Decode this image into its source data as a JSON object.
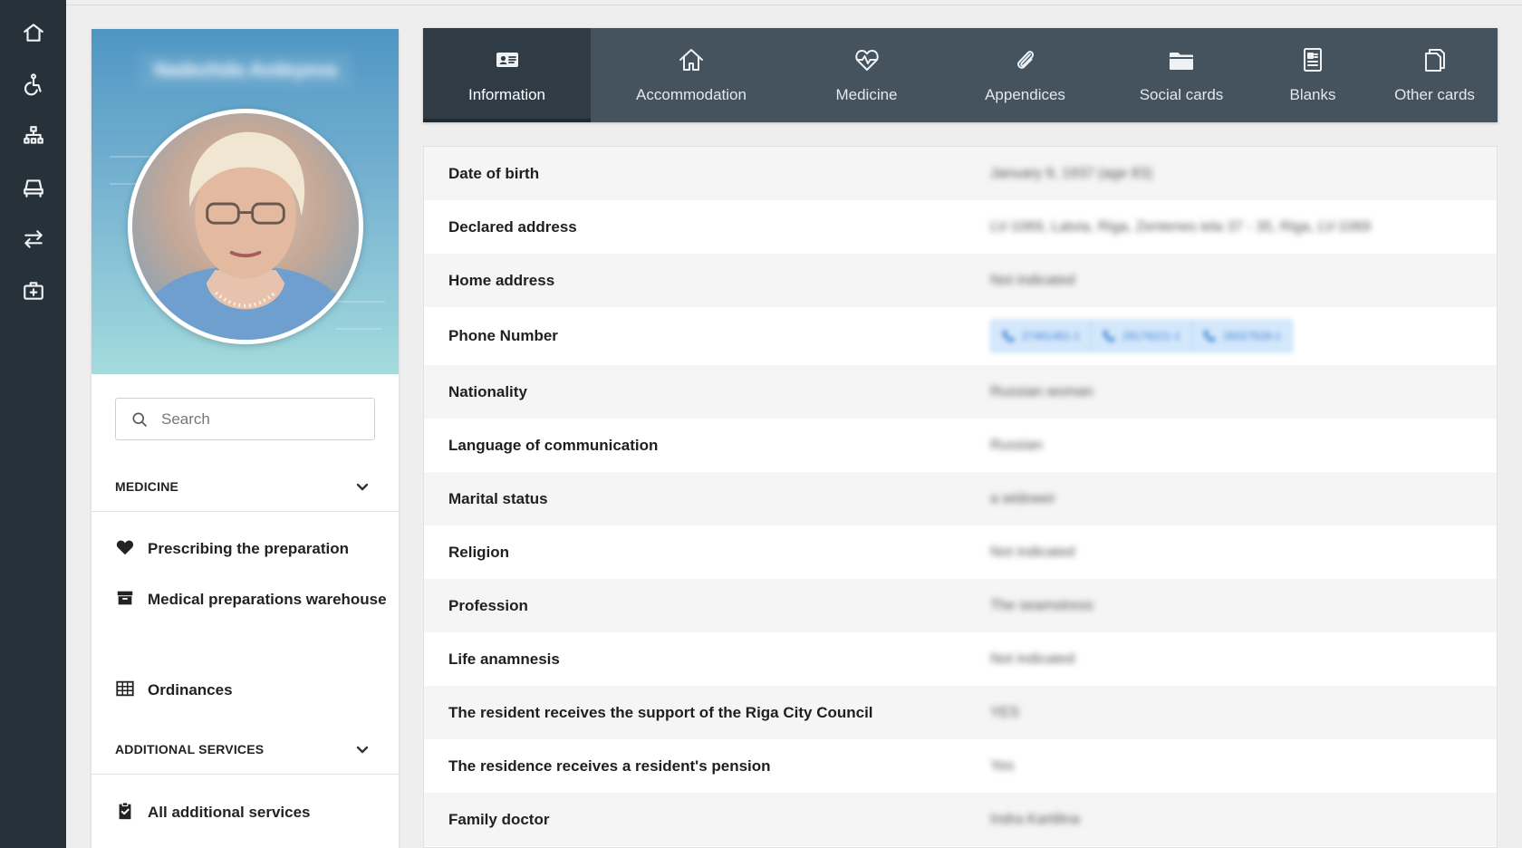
{
  "rail": {
    "items": [
      {
        "name": "home",
        "icon": "home-icon"
      },
      {
        "name": "accessibility",
        "icon": "wheelchair-icon"
      },
      {
        "name": "org-structure",
        "icon": "sitemap-icon"
      },
      {
        "name": "bed",
        "icon": "bed-icon"
      },
      {
        "name": "transfer",
        "icon": "arrows-exchange-icon"
      },
      {
        "name": "medical-kit",
        "icon": "first-aid-kit-icon"
      }
    ]
  },
  "profile": {
    "name": "Nadezhda Avdeyeva"
  },
  "search": {
    "placeholder": "Search"
  },
  "sections": {
    "medicine": {
      "title": "MEDICINE",
      "items": [
        {
          "label": "Prescribing the preparation",
          "icon": "heart-icon"
        },
        {
          "label": "Medical preparations warehouse",
          "icon": "archive-box-icon"
        },
        {
          "label": "Ordinances",
          "icon": "table-icon"
        }
      ]
    },
    "additional": {
      "title": "ADDITIONAL SERVICES",
      "items": [
        {
          "label": "All additional services",
          "icon": "clipboard-check-icon"
        }
      ]
    }
  },
  "tabs": [
    {
      "label": "Information",
      "icon": "id-card-icon",
      "active": true
    },
    {
      "label": "Accommodation",
      "icon": "house-icon",
      "active": false
    },
    {
      "label": "Medicine",
      "icon": "heartbeat-icon",
      "active": false
    },
    {
      "label": "Appendices",
      "icon": "paperclip-icon",
      "active": false
    },
    {
      "label": "Social cards",
      "icon": "folder-icon",
      "active": false
    },
    {
      "label": "Blanks",
      "icon": "document-icon",
      "active": false
    },
    {
      "label": "Other cards",
      "icon": "copy-icon",
      "active": false
    }
  ],
  "info": {
    "rows": [
      {
        "label": "Date of birth",
        "value": "January 9, 1937 (age 83)"
      },
      {
        "label": "Declared address",
        "value": "LV-1069, Latvia, Riga, Zentenes iela 37 - 35, Riga, LV-1069"
      },
      {
        "label": "Home address",
        "value": "Not indicated"
      },
      {
        "label": "Phone Number",
        "value": ""
      },
      {
        "label": "Nationality",
        "value": "Russian woman"
      },
      {
        "label": "Language of communication",
        "value": "Russian"
      },
      {
        "label": "Marital status",
        "value": "a widower"
      },
      {
        "label": "Religion",
        "value": "Not indicated"
      },
      {
        "label": "Profession",
        "value": "The seamstress"
      },
      {
        "label": "Life anamnesis",
        "value": "Not indicated"
      },
      {
        "label": "The resident receives the support of the Riga City Council",
        "value": "YES"
      },
      {
        "label": "The residence receives a resident's pension",
        "value": "Yes"
      },
      {
        "label": "Family doctor",
        "value": "Indra Kartilina"
      }
    ],
    "phones": [
      "27461461-1",
      "29176221-1",
      "26027628-1"
    ]
  },
  "colors": {
    "rail": "#27313a",
    "tabbar": "#45535e",
    "tab_active": "#2f3b45",
    "profile_gradient_top": "#4f96c4",
    "profile_gradient_bottom": "#a3dbdd",
    "phone_chip": "#d4e8fb"
  }
}
